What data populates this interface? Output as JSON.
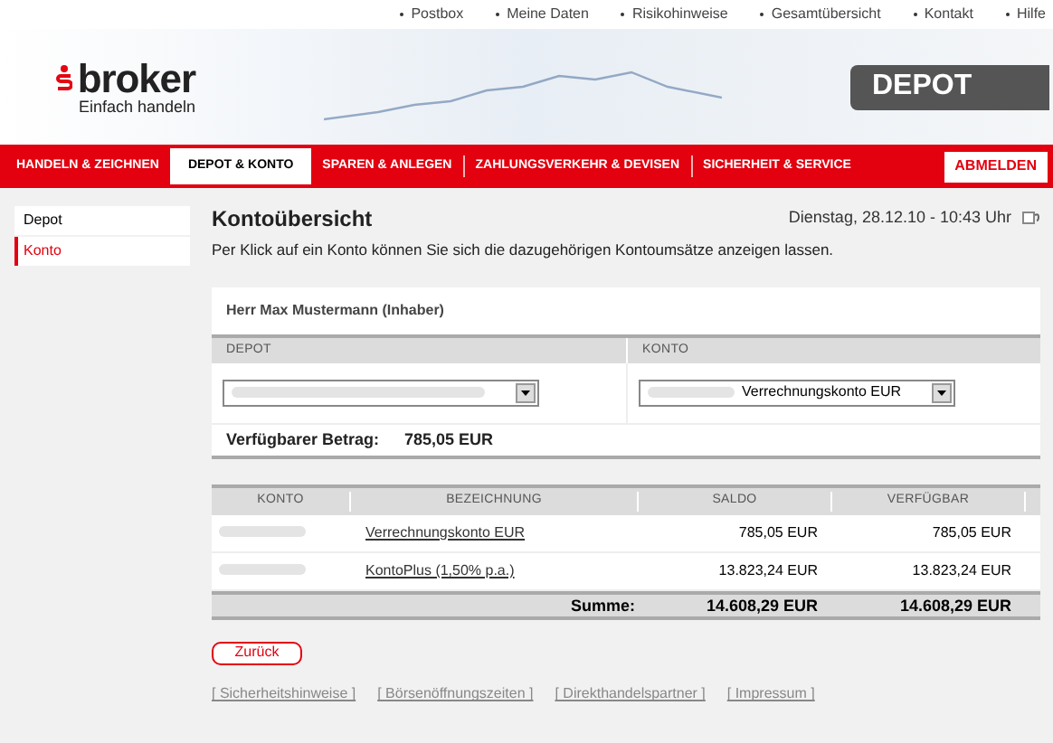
{
  "top_links": [
    "Postbox",
    "Meine Daten",
    "Risikohinweise",
    "Gesamtübersicht",
    "Kontakt",
    "Hilfe"
  ],
  "logo": {
    "name": "broker",
    "tagline": "Einfach handeln"
  },
  "banner_label": "DEPOT",
  "nav": [
    {
      "label": "HANDELN & ZEICHNEN",
      "selected": false
    },
    {
      "label": "DEPOT & KONTO",
      "selected": true
    },
    {
      "label": "SPAREN & ANLEGEN",
      "selected": false
    },
    {
      "label": "ZAHLUNGSVERKEHR & DEVISEN",
      "selected": false
    },
    {
      "label": "SICHERHEIT & SERVICE",
      "selected": false
    }
  ],
  "logout": "ABMELDEN",
  "sidebar": [
    {
      "label": "Depot",
      "selected": false
    },
    {
      "label": "Konto",
      "selected": true
    }
  ],
  "title": "Kontoübersicht",
  "datetime": "Dienstag, 28.12.10 - 10:43 Uhr",
  "intro": "Per Klick auf ein Konto können Sie sich die dazugehörigen Kontoumsätze anzeigen lassen.",
  "owner": "Herr Max Mustermann (Inhaber)",
  "selectors": [
    {
      "label": "DEPOT"
    },
    {
      "label": "KONTO",
      "value": "Verrechnungskonto EUR"
    }
  ],
  "available": {
    "label": "Verfügbarer Betrag:",
    "value": "785,05 EUR"
  },
  "table": {
    "columns": [
      "KONTO",
      "BEZEICHNUNG",
      "SALDO",
      "VERFÜGBAR"
    ],
    "rows": [
      {
        "name": "Verrechnungskonto EUR",
        "saldo": "785,05 EUR",
        "available": "785,05 EUR"
      },
      {
        "name": "KontoPlus (1,50% p.a.)",
        "saldo": "13.823,24 EUR",
        "available": "13.823,24 EUR"
      }
    ],
    "sum_label": "Summe:",
    "sum_saldo": "14.608,29 EUR",
    "sum_available": "14.608,29 EUR"
  },
  "back_button": "Zurück",
  "footer_links": [
    "[ Sicherheitshinweise ]",
    "[ Börsenöffnungszeiten ]",
    "[ Direkthandelspartner ]",
    "[ Impressum ]"
  ]
}
